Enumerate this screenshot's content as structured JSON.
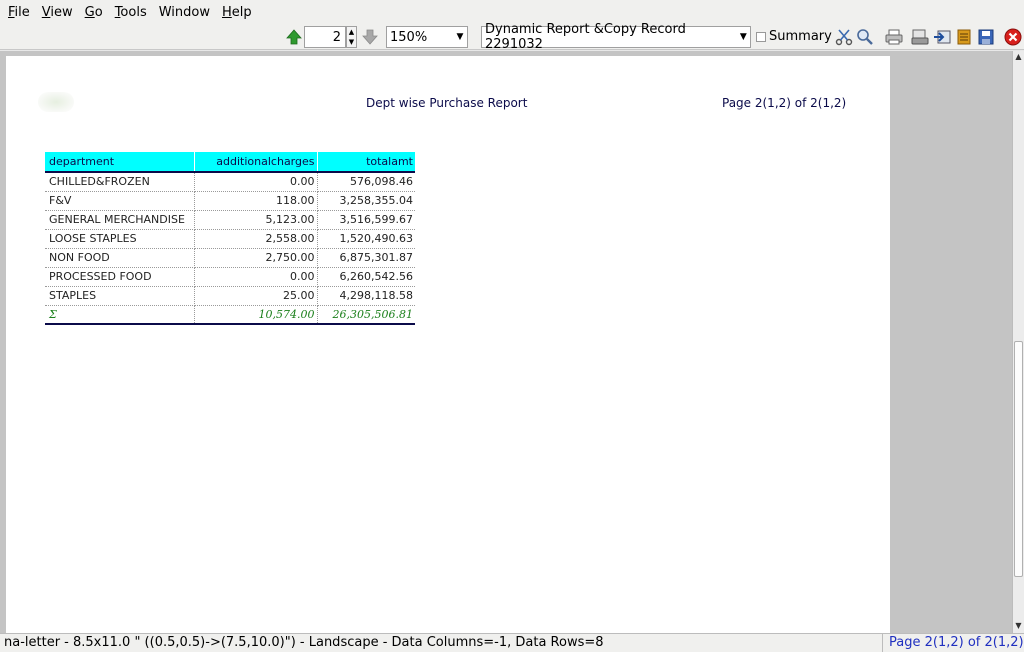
{
  "menu": {
    "items": [
      {
        "u": "F",
        "rest": "ile"
      },
      {
        "u": "V",
        "rest": "iew"
      },
      {
        "u": "G",
        "rest": "o"
      },
      {
        "u": "T",
        "rest": "ools"
      },
      {
        "u": "",
        "rest": "Window"
      },
      {
        "u": "H",
        "rest": "elp"
      }
    ]
  },
  "toolbar": {
    "page_number": "2",
    "zoom": "150%",
    "report": "Dynamic Report &Copy Record 2291032",
    "summary_label": "Summary",
    "summary_checked": false
  },
  "report": {
    "title": "Dept wise Purchase Report",
    "page_label": "Page 2(1,2) of 2(1,2)",
    "columns": [
      "department",
      "additionalcharges",
      "totalamt"
    ],
    "rows": [
      [
        "CHILLED&FROZEN",
        "0.00",
        "576,098.46"
      ],
      [
        "F&V",
        "118.00",
        "3,258,355.04"
      ],
      [
        "GENERAL MERCHANDISE",
        "5,123.00",
        "3,516,599.67"
      ],
      [
        "LOOSE STAPLES",
        "2,558.00",
        "1,520,490.63"
      ],
      [
        "NON FOOD",
        "2,750.00",
        "6,875,301.87"
      ],
      [
        "PROCESSED FOOD",
        "0.00",
        "6,260,542.56"
      ],
      [
        "STAPLES",
        "25.00",
        "4,298,118.58"
      ]
    ],
    "total": [
      "Σ",
      "10,574.00",
      "26,305,506.81"
    ]
  },
  "status": {
    "left": "na-letter - 8.5x11.0 \" ((0.5,0.5)->(7.5,10.0)\") - Landscape - Data Columns=-1, Data Rows=8",
    "right": "Page 2(1,2) of 2(1,2)"
  },
  "colors": {
    "header_bg": "#00ffff",
    "header_text": "#0b0b4a",
    "total_text": "#1a7f1a",
    "status_right": "#2030c0"
  }
}
